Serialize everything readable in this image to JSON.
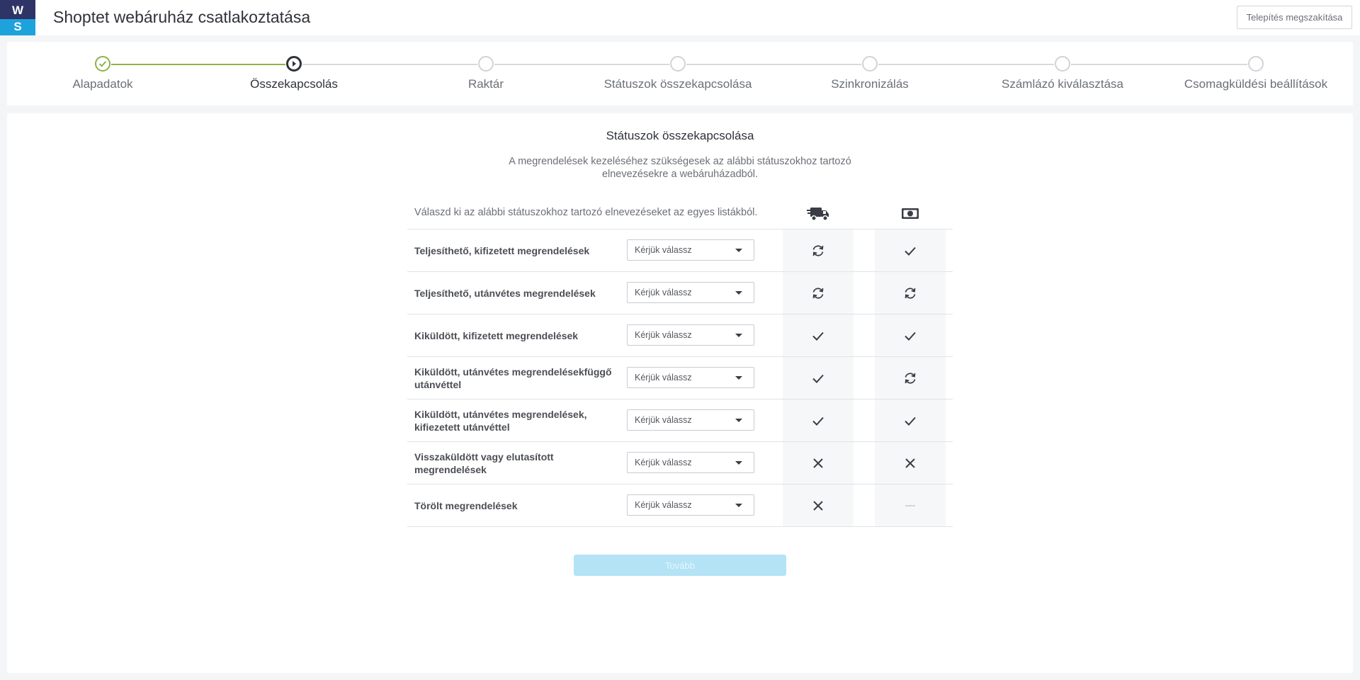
{
  "logo": {
    "top": "W",
    "bottom": "S"
  },
  "header": {
    "title": "Shoptet webáruház csatlakoztatása",
    "cancel_label": "Telepítés megszakítása"
  },
  "stepper": {
    "steps": [
      {
        "label": "Alapadatok",
        "state": "done"
      },
      {
        "label": "Összekapcsolás",
        "state": "active"
      },
      {
        "label": "Raktár",
        "state": "pending"
      },
      {
        "label": "Státuszok összekapcsolása",
        "state": "pending"
      },
      {
        "label": "Szinkronizálás",
        "state": "pending"
      },
      {
        "label": "Számlázó kiválasztása",
        "state": "pending"
      },
      {
        "label": "Csomagküldési beállítások",
        "state": "pending"
      }
    ]
  },
  "main": {
    "title": "Státuszok összekapcsolása",
    "description": "A megrendelések kezeléséhez szükségesek az alábbi státuszokhoz tartozó elnevezésekre a webáruházadból.",
    "instruction": "Válaszd ki az alábbi státuszokhoz tartozó elnevezéseket az egyes listákból.",
    "header_icons": [
      "delivery-truck-icon",
      "cash-icon"
    ],
    "rows": [
      {
        "label": "Teljesíthető, kifizetett megrendelések",
        "select": "Kérjük válassz",
        "c1": "sync",
        "c2": "check"
      },
      {
        "label": "Teljesíthető, utánvétes megrendelések",
        "select": "Kérjük válassz",
        "c1": "sync",
        "c2": "sync"
      },
      {
        "label": "Kiküldött, kifizetett megrendelések",
        "select": "Kérjük válassz",
        "c1": "check",
        "c2": "check"
      },
      {
        "label": "Kiküldött, utánvétes megrendelésekfüggő utánvéttel",
        "select": "Kérjük válassz",
        "c1": "check",
        "c2": "sync"
      },
      {
        "label": "Kiküldött, utánvétes megrendelések, kifiezetett utánvéttel",
        "select": "Kérjük válassz",
        "c1": "check",
        "c2": "check"
      },
      {
        "label": "Visszaküldött vagy elutasított megrendelések",
        "select": "Kérjük válassz",
        "c1": "cross",
        "c2": "cross"
      },
      {
        "label": "Törölt megrendelések",
        "select": "Kérjük válassz",
        "c1": "cross",
        "c2": "dash"
      }
    ],
    "next_label": "Tovább"
  },
  "colors": {
    "accent": "#1ea2dc",
    "brand_dark": "#2e3566",
    "done_green": "#8fb24a",
    "next_disabled": "#b3e3f5"
  }
}
